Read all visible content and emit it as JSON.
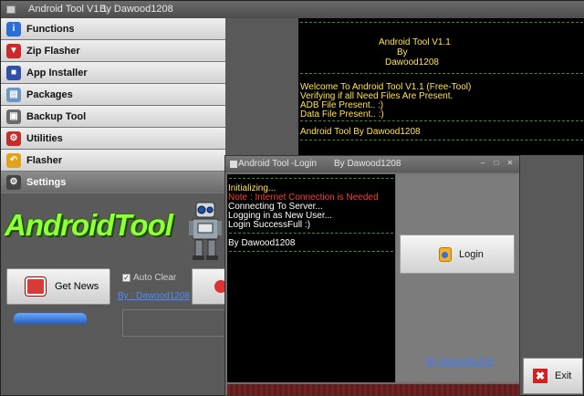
{
  "window": {
    "title": "Android Tool V1.1",
    "author": "By Dawood1208"
  },
  "menu": {
    "items": [
      {
        "label": "Functions",
        "icon": "functions-icon",
        "color": "#2b6fd6"
      },
      {
        "label": "Zip Flasher",
        "icon": "zip-down-arrow-icon",
        "color": "#cc2a2a"
      },
      {
        "label": "App Installer",
        "icon": "app-installer-icon",
        "color": "#2f4fa8"
      },
      {
        "label": "Packages",
        "icon": "packages-icon",
        "color": "#6b95c9"
      },
      {
        "label": "Backup Tool",
        "icon": "backup-icon",
        "color": "#6a6a6a"
      },
      {
        "label": "Utilities",
        "icon": "utilities-icon",
        "color": "#c52b2b"
      },
      {
        "label": "Flasher",
        "icon": "flasher-arrow-icon",
        "color": "#e3a21a"
      },
      {
        "label": "Settings",
        "icon": "gear-icon",
        "color": "#444444"
      }
    ],
    "active_index": 7
  },
  "logo": {
    "text": "AndroidTool"
  },
  "news_button": {
    "label": "Get News"
  },
  "auto_clear": {
    "label": "Auto Clear",
    "checked": true
  },
  "by_link_main": "By : Dawood1208",
  "console_top": {
    "header_lines": [
      "Android Tool V1.1",
      "By",
      "Dawood1208"
    ],
    "lines": [
      "Welcome To Android Tool V1.1 (Free-Tool)",
      "Verifying if all Need Files Are Present.",
      "ADB File Present.. :)",
      "Data File Present.. :)"
    ],
    "footer_line": "Android Tool By Dawood1208"
  },
  "exit_button": {
    "label": "Exit"
  },
  "login_dialog": {
    "title": "Android Tool  -Login",
    "author": "By Dawood1208",
    "console_lines": [
      {
        "text": "Initializing...",
        "color": "#ffe34a"
      },
      {
        "text": "Note : Internet Connection is Needed",
        "color": "#ff3b3b"
      },
      {
        "text": " Connecting To Server...",
        "color": "#ffffff"
      },
      {
        "text": " Logging in as New User...",
        "color": "#ffffff"
      },
      {
        "text": "Login SuccessFull :)",
        "color": "#ffffff"
      }
    ],
    "console_footer": "By Dawood1208",
    "login_button": "Login",
    "by_link": "By Dawood1208"
  }
}
